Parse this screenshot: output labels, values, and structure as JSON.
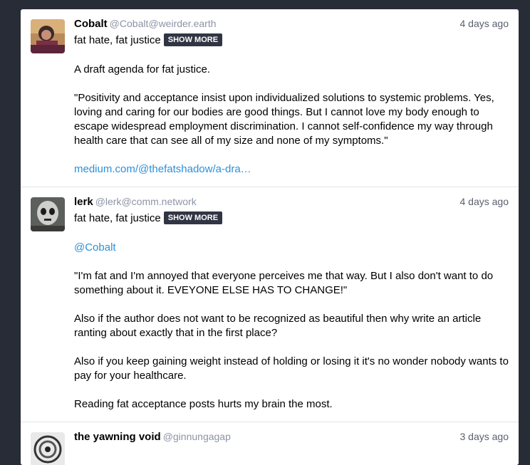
{
  "statuses": [
    {
      "display_name": "Cobalt",
      "acct": "@Cobalt@weirder.earth",
      "time": "4 days ago",
      "spoiler": "fat hate, fat justice",
      "show_more": "SHOW MORE",
      "paragraphs": [
        "A draft agenda for fat justice.",
        "\"Positivity and acceptance insist upon individualized solutions to systemic problems. Yes, loving and caring for our bodies are good things. But I cannot love my body enough to escape widespread employment discrimination. I cannot self-confidence my way through health care that can see all of my size and none of my symptoms.\""
      ],
      "link": "medium.com/@thefatshadow/a-dra…"
    },
    {
      "display_name": "lerk",
      "acct": "@lerk@comm.network",
      "time": "4 days ago",
      "spoiler": "fat hate, fat justice",
      "show_more": "SHOW MORE",
      "mention": "@Cobalt",
      "paragraphs": [
        "\"I'm fat and I'm annoyed that everyone perceives me that way. But I also don't want to do something about it. EVEYONE ELSE HAS TO CHANGE!\"",
        "Also if the author does not want to be recognized as beautiful then why write an article ranting about exactly that in the first place?",
        "Also if you keep gaining weight instead of holding or losing it it's no wonder nobody wants to pay for your healthcare.",
        "Reading fat acceptance posts hurts my brain the most."
      ]
    },
    {
      "display_name": "the yawning void",
      "acct": "@ginnungagap",
      "time": "3 days ago"
    }
  ]
}
